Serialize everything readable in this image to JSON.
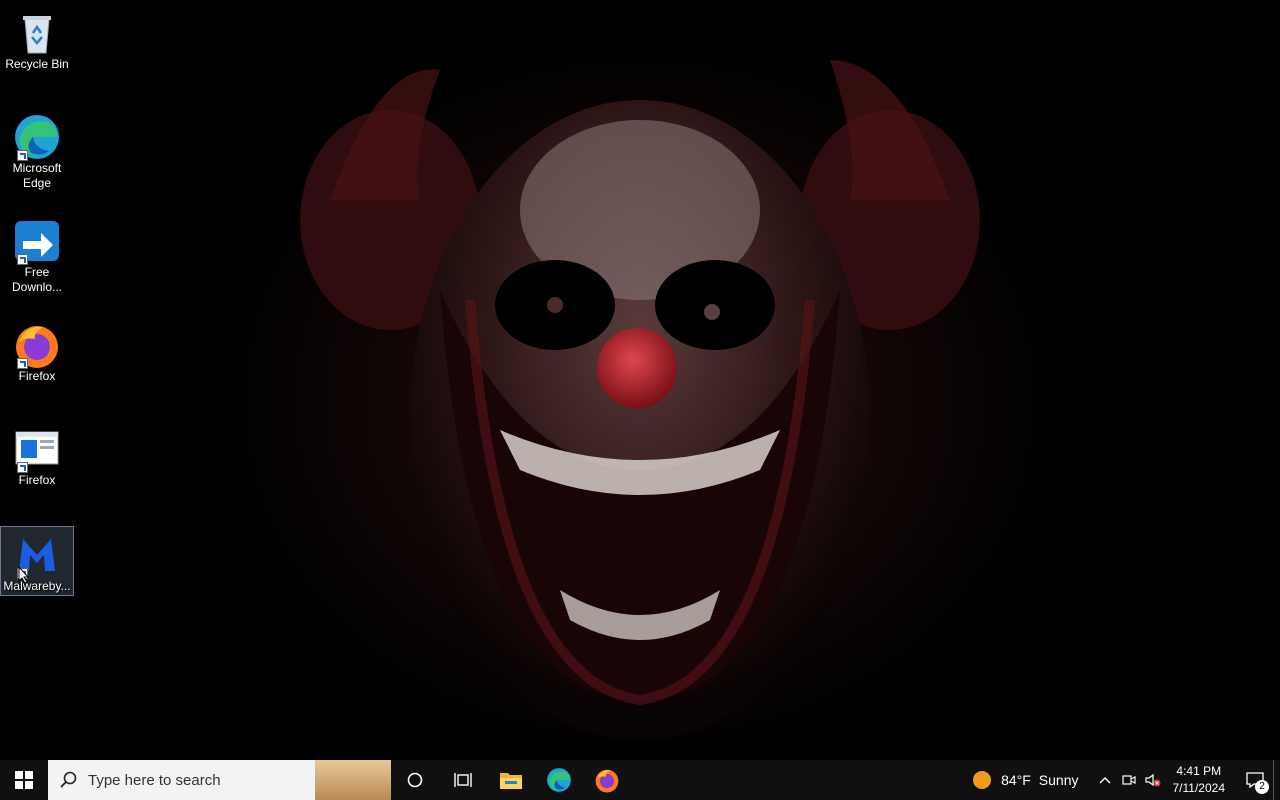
{
  "desktop": {
    "icons": [
      {
        "name": "recycle-bin",
        "label": "Recycle Bin",
        "icon": "recycle-bin-icon"
      },
      {
        "name": "microsoft-edge",
        "label": "Microsoft\nEdge",
        "icon": "edge-icon"
      },
      {
        "name": "free-download-manager",
        "label": "Free\nDownlo...",
        "icon": "download-manager-icon"
      },
      {
        "name": "firefox",
        "label": "Firefox",
        "icon": "firefox-icon"
      },
      {
        "name": "firefox-window",
        "label": "Firefox",
        "icon": "window-app-icon"
      },
      {
        "name": "malwarebytes",
        "label": "Malwareby...",
        "icon": "malwarebytes-icon",
        "selected": true
      }
    ]
  },
  "taskbar": {
    "start_icon": "windows-start-icon",
    "search_placeholder": "Type here to search",
    "pinned": [
      "cortana-icon",
      "task-view-icon",
      "file-explorer-icon",
      "edge-icon",
      "firefox-icon"
    ],
    "weather": {
      "temp": "84°F",
      "condition": "Sunny"
    },
    "clock": {
      "time": "4:41 PM",
      "date": "7/11/2024"
    },
    "notifications_count": "2"
  },
  "colors": {
    "taskbar": "#101010",
    "accent": "#0078d7",
    "weather_sun": "#f39a1d"
  }
}
